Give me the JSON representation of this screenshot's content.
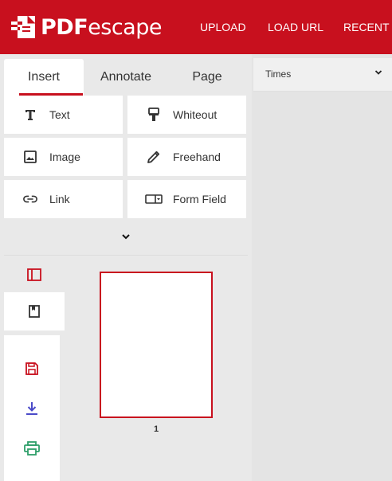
{
  "header": {
    "brand_pdf": "PDF",
    "brand_escape": "escape",
    "nav": [
      {
        "label": "UPLOAD"
      },
      {
        "label": "LOAD URL"
      },
      {
        "label": "RECENT"
      }
    ]
  },
  "tabs": [
    {
      "label": "Insert",
      "active": true
    },
    {
      "label": "Annotate",
      "active": false
    },
    {
      "label": "Page",
      "active": false
    }
  ],
  "tools": [
    {
      "label": "Text",
      "icon": "text-icon"
    },
    {
      "label": "Whiteout",
      "icon": "whiteout-icon"
    },
    {
      "label": "Image",
      "icon": "image-icon"
    },
    {
      "label": "Freehand",
      "icon": "pencil-icon"
    },
    {
      "label": "Link",
      "icon": "link-icon"
    },
    {
      "label": "Form Field",
      "icon": "form-field-icon"
    }
  ],
  "font_selector": {
    "value": "Times"
  },
  "thumbnails": [
    {
      "page_number": "1"
    }
  ],
  "colors": {
    "brand_red": "#c8101e",
    "save": "#c8101e",
    "download": "#4a4ac8",
    "print": "#2e9e6a"
  }
}
